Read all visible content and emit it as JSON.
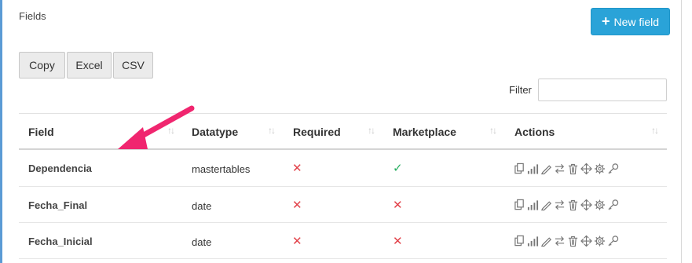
{
  "panel": {
    "title": "Fields"
  },
  "toolbar": {
    "new_field_label": "New field"
  },
  "export_buttons": [
    {
      "label": "Copy"
    },
    {
      "label": "Excel"
    },
    {
      "label": "CSV"
    }
  ],
  "filter": {
    "label": "Filter",
    "value": ""
  },
  "table": {
    "columns": [
      {
        "label": "Field"
      },
      {
        "label": "Datatype"
      },
      {
        "label": "Required"
      },
      {
        "label": "Marketplace"
      },
      {
        "label": "Actions"
      }
    ],
    "rows": [
      {
        "field": "Dependencia",
        "datatype": "mastertables",
        "required": false,
        "marketplace": true
      },
      {
        "field": "Fecha_Final",
        "datatype": "date",
        "required": false,
        "marketplace": false
      },
      {
        "field": "Fecha_Inicial",
        "datatype": "date",
        "required": false,
        "marketplace": false
      }
    ],
    "action_icons": [
      "copy-icon",
      "signal-bars-icon",
      "pencil-icon",
      "exchange-icon",
      "trash-icon",
      "move-icon",
      "gear-icon",
      "key-icon"
    ]
  },
  "symbols": {
    "sort": "↑↓",
    "cross": "✕",
    "check": "✓"
  },
  "colors": {
    "primary": "#2aa3d8",
    "cross": "#e2424a",
    "check": "#27ae60",
    "annotation_arrow": "#f0266f"
  }
}
